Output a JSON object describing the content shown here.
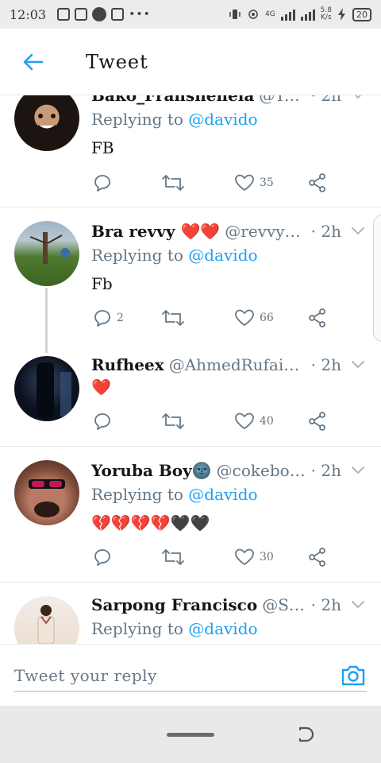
{
  "status_bar": {
    "time": "12:03",
    "network_type": "4G",
    "speed_value": "5.8",
    "speed_unit": "K/s",
    "battery": "20"
  },
  "header": {
    "back_icon": "arrow-left-icon",
    "title": "Tweet"
  },
  "tweets": [
    {
      "name": "Bako_Fransheneia",
      "handle": "@Yonn...",
      "time": "· 2h",
      "reply_prefix": "Replying to",
      "reply_to": "@davido",
      "text": "FB",
      "replies": "",
      "likes": "35"
    },
    {
      "name": "Bra revvy ❤️❤️",
      "handle": "@revvyde...",
      "time": "· 2h",
      "reply_prefix": "Replying to",
      "reply_to": "@davido",
      "text": "Fb",
      "replies": "2",
      "likes": "66"
    },
    {
      "name": "Rufheex",
      "handle": "@AhmedRufai20...",
      "time": "· 2h",
      "text": "❤️",
      "replies": "",
      "likes": "40"
    },
    {
      "name": "Yoruba Boy🌚",
      "handle": "@cokebooii",
      "time": "· 2h",
      "reply_prefix": "Replying to",
      "reply_to": "@davido",
      "text": "💔💔💔💔🖤🖤",
      "replies": "",
      "likes": "30"
    },
    {
      "name": "Sarpong Francisco",
      "handle": "@Sarp...",
      "time": "· 2h",
      "reply_prefix": "Replying to",
      "reply_to": "@davido"
    }
  ],
  "reply_bar": {
    "placeholder": "Tweet your reply",
    "camera_icon": "camera-icon"
  },
  "colors": {
    "accent": "#1da1f2",
    "secondary_text": "#657786",
    "heart": "#e0245e"
  }
}
